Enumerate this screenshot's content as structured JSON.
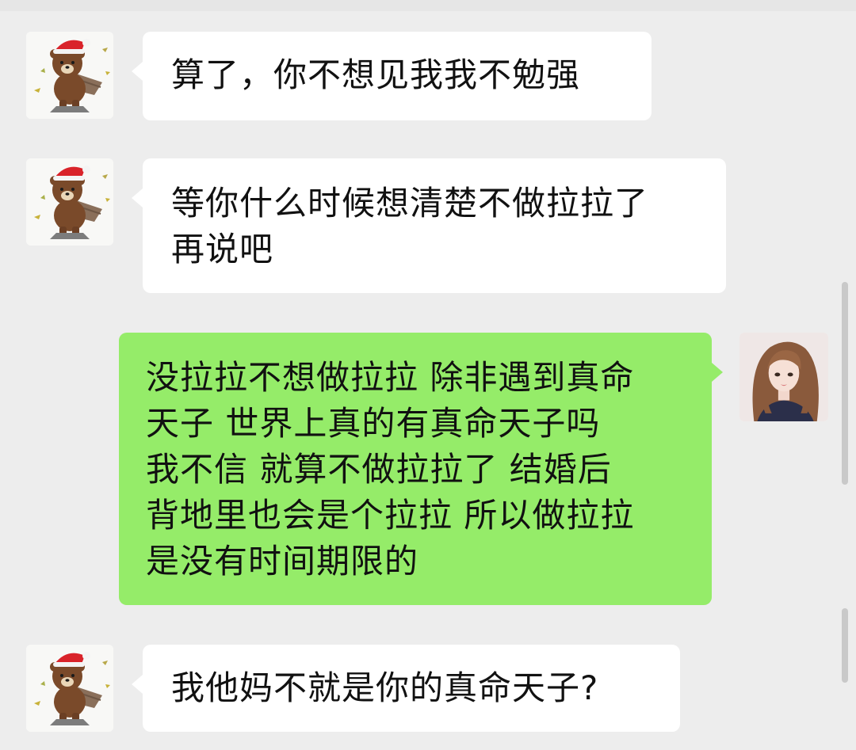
{
  "messages": [
    {
      "sender": "other",
      "avatar": "brown-bear-santa-hat-icon",
      "lines": [
        "算了，你不想见我我不勉强"
      ]
    },
    {
      "sender": "other",
      "avatar": "brown-bear-santa-hat-icon",
      "lines": [
        "等你什么时候想清楚不做拉拉了",
        "再说吧"
      ]
    },
    {
      "sender": "self",
      "avatar": "girl-portrait-icon",
      "lines": [
        "没拉拉不想做拉拉 除非遇到真命",
        "天子 世界上真的有真命天子吗",
        "我不信 就算不做拉拉了 结婚后",
        "背地里也会是个拉拉 所以做拉拉",
        "是没有时间期限的"
      ]
    },
    {
      "sender": "other",
      "avatar": "brown-bear-santa-hat-icon",
      "lines": [
        "我他妈不就是你的真命天子?"
      ]
    }
  ],
  "colors": {
    "background": "#ededed",
    "incoming_bubble": "#ffffff",
    "outgoing_bubble": "#95ec69"
  }
}
